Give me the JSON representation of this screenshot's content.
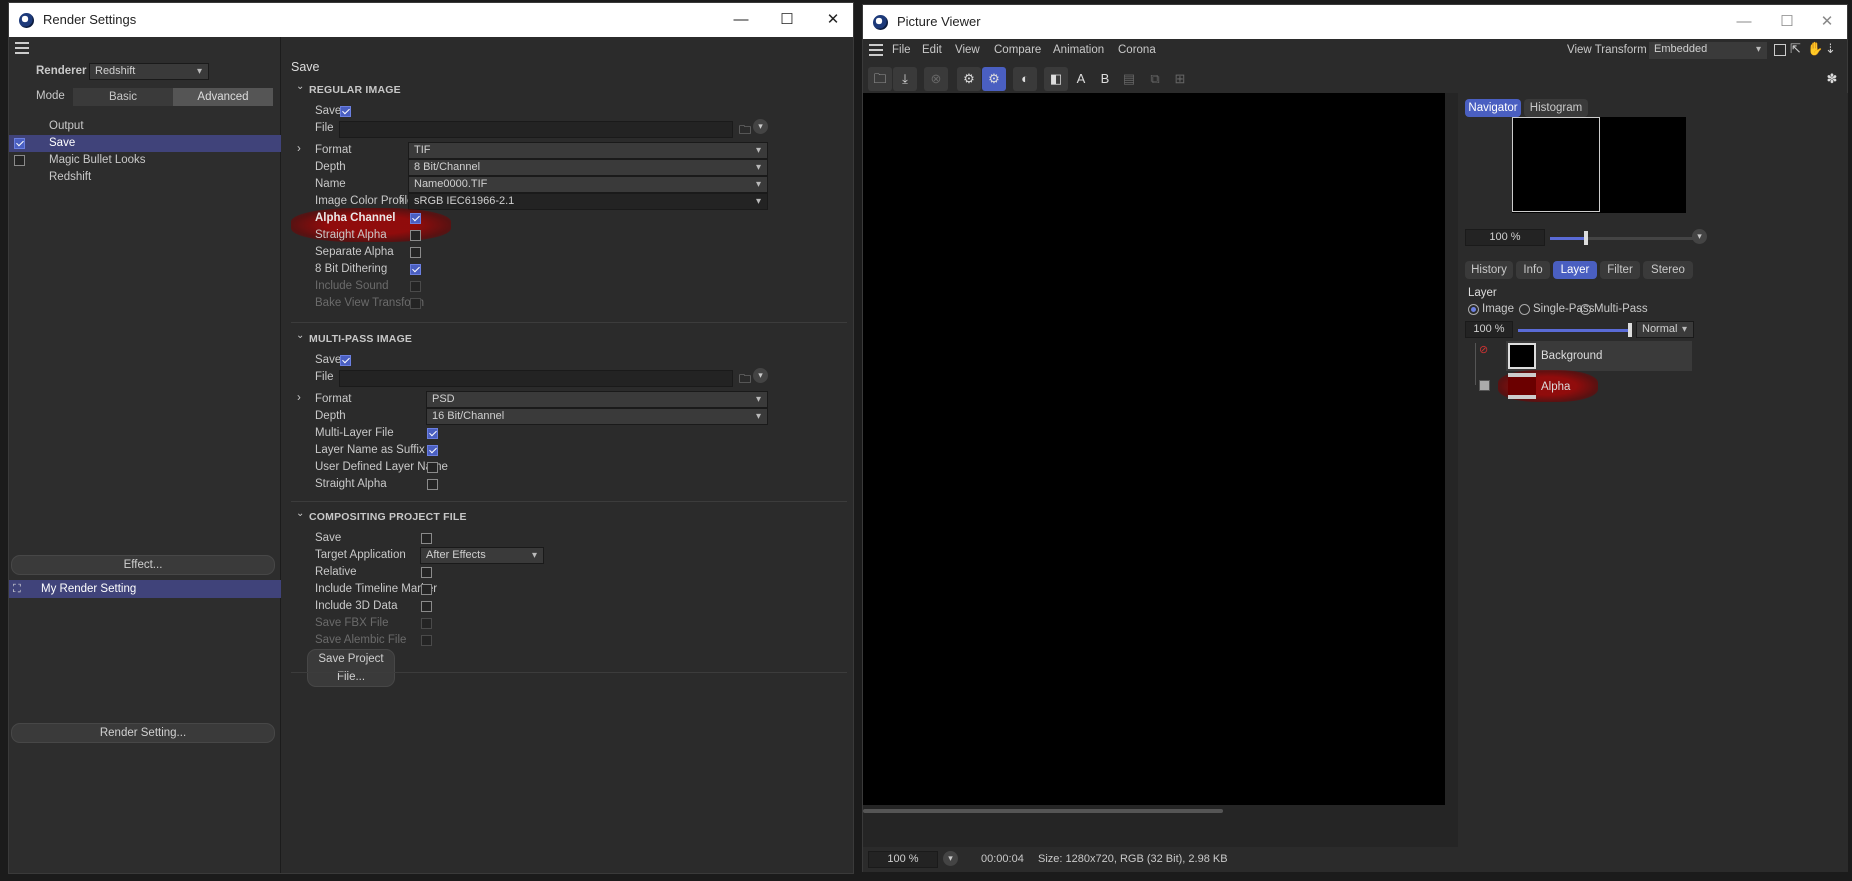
{
  "render_settings": {
    "title": "Render Settings",
    "renderer_label": "Renderer",
    "renderer_value": "Redshift",
    "mode_label": "Mode",
    "mode_basic": "Basic",
    "mode_advanced": "Advanced",
    "tree": [
      {
        "label": "Output"
      },
      {
        "label": "Save"
      },
      {
        "label": "Magic Bullet Looks"
      },
      {
        "label": "Redshift"
      }
    ],
    "effect_button": "Effect...",
    "render_setting_item": "My Render Setting",
    "render_setting_button": "Render Setting...",
    "panel_title": "Save",
    "regular": {
      "heading": "REGULAR IMAGE",
      "save_label": "Save",
      "file_label": "File",
      "format_label": "Format",
      "format_value": "TIF",
      "depth_label": "Depth",
      "depth_value": "8 Bit/Channel",
      "name_label": "Name",
      "name_value": "Name0000.TIF",
      "profile_label": "Image Color Profile",
      "profile_value": "sRGB IEC61966-2.1",
      "alpha_label": "Alpha Channel",
      "straight_label": "Straight Alpha",
      "separate_label": "Separate Alpha",
      "dither_label": "8 Bit Dithering",
      "sound_label": "Include Sound",
      "bake_label": "Bake View Transform"
    },
    "multipass": {
      "heading": "MULTI-PASS IMAGE",
      "save_label": "Save",
      "file_label": "File",
      "format_label": "Format",
      "format_value": "PSD",
      "depth_label": "Depth",
      "depth_value": "16 Bit/Channel",
      "multilayer_label": "Multi-Layer File",
      "suffix_label": "Layer Name as Suffix",
      "userdef_label": "User Defined Layer Name",
      "straight_label": "Straight Alpha"
    },
    "compositing": {
      "heading": "COMPOSITING PROJECT FILE",
      "save_label": "Save",
      "target_label": "Target Application",
      "target_value": "After Effects",
      "relative_label": "Relative",
      "timeline_label": "Include Timeline Marker",
      "data3d_label": "Include 3D Data",
      "fbx_label": "Save FBX File",
      "alembic_label": "Save Alembic File",
      "save_project_button": "Save Project File..."
    }
  },
  "picture_viewer": {
    "title": "Picture Viewer",
    "menu": [
      "File",
      "Edit",
      "View",
      "Compare",
      "Animation",
      "Corona"
    ],
    "view_transform_label": "View Transform",
    "view_transform_value": "Embedded",
    "toolbar_text_a": "A",
    "toolbar_text_b": "B",
    "nav_tabs": [
      "Navigator",
      "Histogram"
    ],
    "nav_zoom": "100 %",
    "info_tabs": [
      "History",
      "Info",
      "Layer",
      "Filter",
      "Stereo"
    ],
    "layer_heading": "Layer",
    "layer_modes": [
      "Image",
      "Single-Pass",
      "Multi-Pass"
    ],
    "layer_opacity": "100 %",
    "blend_mode": "Normal",
    "layers": [
      {
        "name": "Background"
      },
      {
        "name": "Alpha"
      }
    ],
    "status_zoom": "100 %",
    "status_time": "00:00:04",
    "status_size": "Size: 1280x720, RGB (32 Bit), 2.98 KB"
  },
  "colors": {
    "accent": "#4a5fc1",
    "highlight_red": "#8b0a0a",
    "panel_bg": "#2b2b2b",
    "canvas": "#000000"
  }
}
